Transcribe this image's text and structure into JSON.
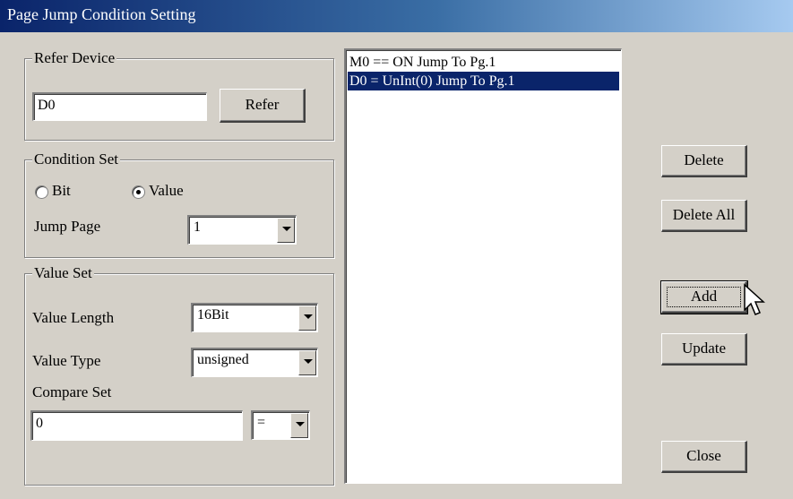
{
  "window": {
    "title": "Page Jump Condition Setting"
  },
  "refer_device": {
    "legend": "Refer Device",
    "input_value": "D0",
    "refer_button": "Refer"
  },
  "condition_set": {
    "legend": "Condition Set",
    "bit_label": "Bit",
    "value_label": "Value",
    "selected": "Value",
    "jump_page_label": "Jump Page",
    "jump_page_value": "1"
  },
  "value_set": {
    "legend": "Value Set",
    "length_label": "Value Length",
    "length_value": "16Bit",
    "type_label": "Value Type",
    "type_value": "unsigned",
    "compare_label": "Compare Set",
    "compare_value": "0",
    "operator_value": "="
  },
  "conditions_list": {
    "items": [
      {
        "text": "M0 == ON Jump To Pg.1",
        "selected": false
      },
      {
        "text": "D0 = UnInt(0) Jump To Pg.1",
        "selected": true
      }
    ]
  },
  "buttons": {
    "delete": "Delete",
    "delete_all": "Delete All",
    "add": "Add",
    "update": "Update",
    "close": "Close"
  },
  "icons": {
    "cursor": "arrow-cursor-icon"
  },
  "colors": {
    "selection": "#0a246a",
    "titlebar_start": "#0a246a",
    "titlebar_end": "#a6caf0"
  }
}
